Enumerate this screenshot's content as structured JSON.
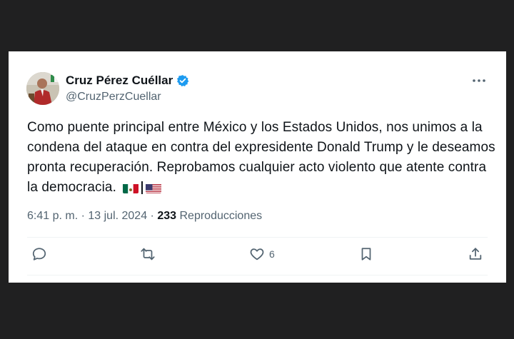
{
  "tweet": {
    "author_name": "Cruz Pérez Cuéllar",
    "author_handle": "@CruzPerzCuellar",
    "verified": true,
    "text": "Como puente principal entre México y los Estados Unidos, nos unimos a la condena del ataque en contra del expresidente Donald Trump y le deseamos pronta recuperación. Reprobamos cualquier acto violento que atente contra la democracia.",
    "flags": [
      "mexico-flag",
      "usa-flag"
    ],
    "timestamp": "6:41 p. m. · 13 jul. 2024",
    "separator": " · ",
    "views_count": "233",
    "views_label": "Reproducciones",
    "likes_count": "6"
  },
  "colors": {
    "background": "#202021",
    "card": "#ffffff",
    "text": "#0f1419",
    "secondary": "#536471",
    "verified": "#1d9bf0"
  },
  "icons": [
    "more-icon",
    "reply-icon",
    "retweet-icon",
    "like-icon",
    "bookmark-icon",
    "share-icon",
    "verified-badge-icon"
  ]
}
